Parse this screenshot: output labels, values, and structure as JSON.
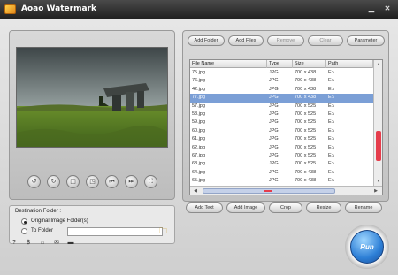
{
  "window": {
    "title": "Aoao Watermark",
    "minimize_icon": "minimize-icon",
    "close_icon": "close-icon"
  },
  "preview": {
    "controls": [
      {
        "icon": "rotate-left-icon",
        "glyph": "↺"
      },
      {
        "icon": "rotate-right-icon",
        "glyph": "↻"
      },
      {
        "icon": "actual-size-icon",
        "glyph": "◫"
      },
      {
        "icon": "fit-window-icon",
        "glyph": "◳"
      },
      {
        "icon": "previous-icon",
        "glyph": "⏮"
      },
      {
        "icon": "next-icon",
        "glyph": "⏭"
      },
      {
        "icon": "fullscreen-icon",
        "glyph": "⛶"
      }
    ]
  },
  "destination": {
    "title": "Destination Folder :",
    "option_original": "Original Image Folder(s)",
    "option_to_folder": "To Folder",
    "selected": "original",
    "folder_value": ""
  },
  "toolbar_top": {
    "add_folder": "Add Folder",
    "add_files": "Add Files",
    "remove": "Remove",
    "clear": "Clear",
    "parameter": "Parameter"
  },
  "file_list": {
    "columns": [
      "File Name",
      "Type",
      "Size",
      "Path"
    ],
    "rows": [
      [
        "75.jpg",
        "JPG",
        "700 x 438",
        "E:\\"
      ],
      [
        "76.jpg",
        "JPG",
        "700 x 438",
        "E:\\"
      ],
      [
        "42.jpg",
        "JPG",
        "700 x 438",
        "E:\\"
      ],
      [
        "77.jpg",
        "JPG",
        "700 x 438",
        "E:\\"
      ],
      [
        "57.jpg",
        "JPG",
        "700 x 525",
        "E:\\"
      ],
      [
        "58.jpg",
        "JPG",
        "700 x 525",
        "E:\\"
      ],
      [
        "59.jpg",
        "JPG",
        "700 x 525",
        "E:\\"
      ],
      [
        "60.jpg",
        "JPG",
        "700 x 525",
        "E:\\"
      ],
      [
        "61.jpg",
        "JPG",
        "700 x 525",
        "E:\\"
      ],
      [
        "62.jpg",
        "JPG",
        "700 x 525",
        "E:\\"
      ],
      [
        "67.jpg",
        "JPG",
        "700 x 525",
        "E:\\"
      ],
      [
        "68.jpg",
        "JPG",
        "700 x 525",
        "E:\\"
      ],
      [
        "64.jpg",
        "JPG",
        "700 x 438",
        "E:\\"
      ],
      [
        "65.jpg",
        "JPG",
        "700 x 438",
        "E:\\"
      ]
    ],
    "selected_index": 3
  },
  "toolbar_bottom": {
    "add_text": "Add Text",
    "add_image": "Add Image",
    "crop": "Crop",
    "resize": "Resize",
    "rename": "Rename"
  },
  "status_icons": [
    "help-icon",
    "dollar-icon",
    "home-icon",
    "email-icon",
    "keyboard-icon"
  ],
  "run": {
    "label": "Run"
  },
  "colors": {
    "selection": "#7b9fd6",
    "run_button": "#2d7fd6",
    "scroll_marker": "#e53d4c"
  }
}
